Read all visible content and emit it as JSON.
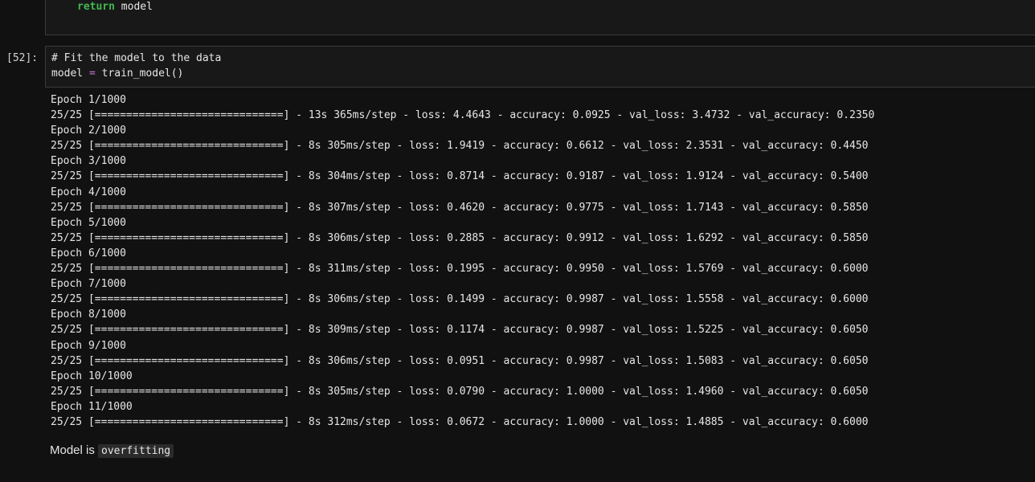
{
  "prev_cell": {
    "keyword": "return",
    "rest": " model"
  },
  "cell": {
    "prompt": "[52]:",
    "comment": "# Fit the model to the data",
    "code_var": "model",
    "code_op": " = ",
    "code_call": "train_model()"
  },
  "output_lines": [
    "Epoch 1/1000",
    "25/25 [==============================] - 13s 365ms/step - loss: 4.4643 - accuracy: 0.0925 - val_loss: 3.4732 - val_accuracy: 0.2350",
    "Epoch 2/1000",
    "25/25 [==============================] - 8s 305ms/step - loss: 1.9419 - accuracy: 0.6612 - val_loss: 2.3531 - val_accuracy: 0.4450",
    "Epoch 3/1000",
    "25/25 [==============================] - 8s 304ms/step - loss: 0.8714 - accuracy: 0.9187 - val_loss: 1.9124 - val_accuracy: 0.5400",
    "Epoch 4/1000",
    "25/25 [==============================] - 8s 307ms/step - loss: 0.4620 - accuracy: 0.9775 - val_loss: 1.7143 - val_accuracy: 0.5850",
    "Epoch 5/1000",
    "25/25 [==============================] - 8s 306ms/step - loss: 0.2885 - accuracy: 0.9912 - val_loss: 1.6292 - val_accuracy: 0.5850",
    "Epoch 6/1000",
    "25/25 [==============================] - 8s 311ms/step - loss: 0.1995 - accuracy: 0.9950 - val_loss: 1.5769 - val_accuracy: 0.6000",
    "Epoch 7/1000",
    "25/25 [==============================] - 8s 306ms/step - loss: 0.1499 - accuracy: 0.9987 - val_loss: 1.5558 - val_accuracy: 0.6000",
    "Epoch 8/1000",
    "25/25 [==============================] - 8s 309ms/step - loss: 0.1174 - accuracy: 0.9987 - val_loss: 1.5225 - val_accuracy: 0.6050",
    "Epoch 9/1000",
    "25/25 [==============================] - 8s 306ms/step - loss: 0.0951 - accuracy: 0.9987 - val_loss: 1.5083 - val_accuracy: 0.6050",
    "Epoch 10/1000",
    "25/25 [==============================] - 8s 305ms/step - loss: 0.0790 - accuracy: 1.0000 - val_loss: 1.4960 - val_accuracy: 0.6050",
    "Epoch 11/1000",
    "25/25 [==============================] - 8s 312ms/step - loss: 0.0672 - accuracy: 1.0000 - val_loss: 1.4885 - val_accuracy: 0.6000"
  ],
  "markdown": {
    "text": "Model is ",
    "code": "overfitting"
  }
}
